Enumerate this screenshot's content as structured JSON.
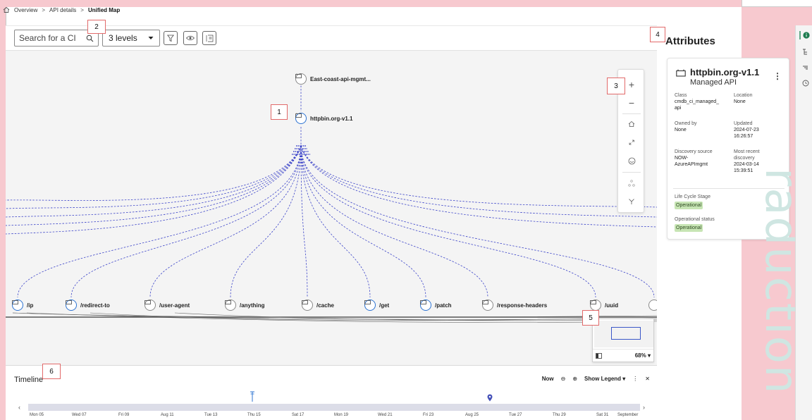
{
  "breadcrumb": {
    "items": [
      "Overview",
      "API details",
      "Unified Map"
    ]
  },
  "toolbar": {
    "search_placeholder": "Search for a CI",
    "levels_value": "3 levels"
  },
  "map": {
    "nodes": {
      "parent": "East-coast-api-mgmt...",
      "selected": "httpbin.org-v1.1",
      "children": [
        "/ip",
        "/redirect-to",
        "/user-agent",
        "/anything",
        "/cache",
        "/get",
        "/patch",
        "/response-headers",
        "/uuid"
      ]
    },
    "zoom_percent": "68%"
  },
  "timeline": {
    "title": "Timeline",
    "now_label": "Now",
    "legend_label": "Show Legend",
    "ticks": [
      "Mon 05",
      "Wed 07",
      "Fri 09",
      "Aug 11",
      "Tue 13",
      "Thu 15",
      "Sat 17",
      "Mon 19",
      "Wed 21",
      "Fri 23",
      "Aug 25",
      "Tue 27",
      "Thu 29",
      "Sat 31",
      "September"
    ]
  },
  "attributes": {
    "title": "Attributes",
    "name": "httpbin.org-v1.1",
    "type": "Managed API",
    "class_label": "Class",
    "class_value": "cmdb_ci_managed_\napi",
    "location_label": "Location",
    "location_value": "None",
    "owned_label": "Owned by",
    "owned_value": "None",
    "updated_label": "Updated",
    "updated_value": "2024-07-23\n16:26:57",
    "discovery_label": "Discovery source",
    "discovery_value": "NOW-\nAzureAPImgmt",
    "recent_label": "Most recent\ndiscovery",
    "recent_value": "2024-03-14\n15:39:51",
    "lifecycle_label": "Life Cycle Stage",
    "lifecycle_value": "Operational",
    "opstatus_label": "Operational status",
    "opstatus_value": "Operational"
  },
  "watermark": "raduction",
  "callouts": [
    "1",
    "2",
    "3",
    "4",
    "5",
    "6"
  ],
  "colors": {
    "link": "#3d45c9",
    "selected": "#2c73d2",
    "badge": "#c7e5b4"
  }
}
